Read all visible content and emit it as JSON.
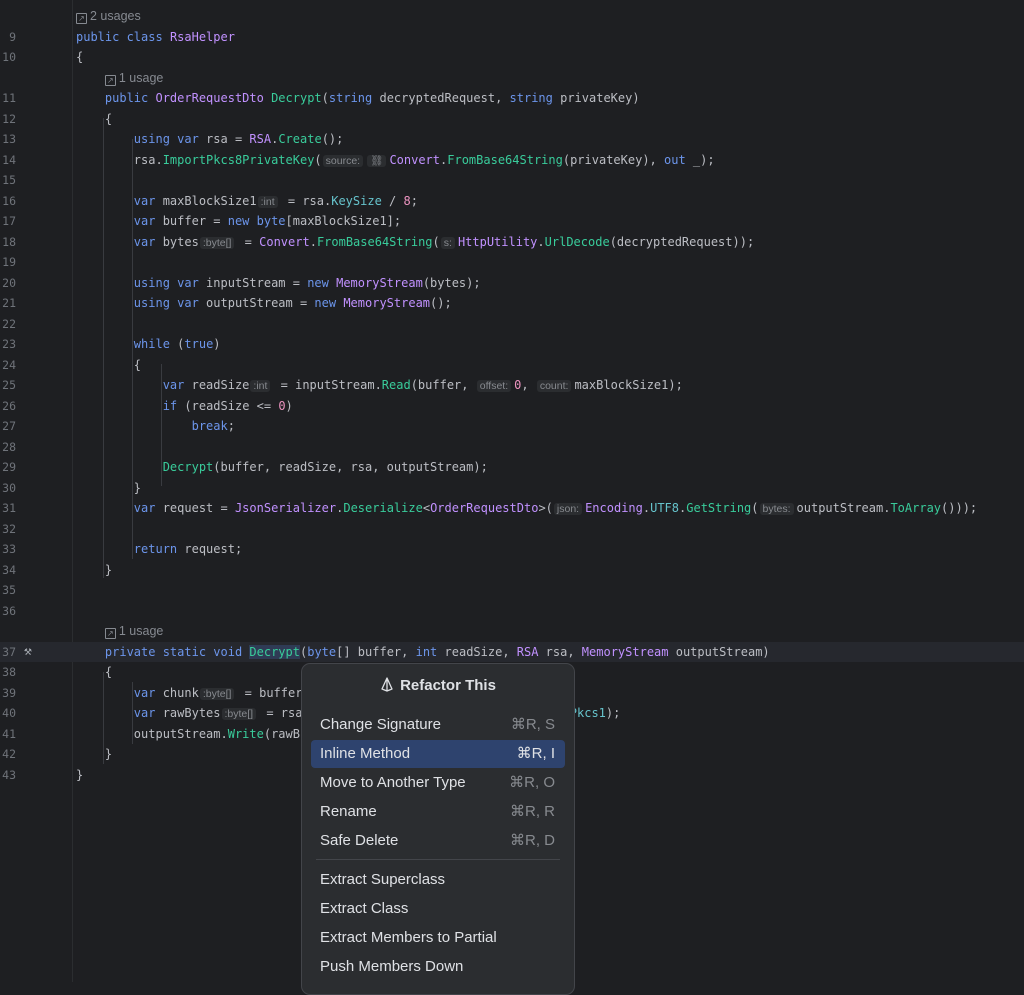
{
  "colors": {
    "background": "#1e1f22",
    "keyword": "#6c95eb",
    "type": "#c191ff",
    "method": "#39cc9b",
    "number": "#ed94c0",
    "selection": "#2e436e"
  },
  "editor": {
    "rows": [
      {
        "usage": "2 usages",
        "indent": 0
      },
      {
        "ln": "9",
        "t": [
          [
            "kw",
            "public "
          ],
          [
            "kw",
            "class "
          ],
          [
            "ty",
            "RsaHelper"
          ]
        ]
      },
      {
        "ln": "10",
        "t": [
          [
            "tx",
            "{"
          ]
        ]
      },
      {
        "usage": "1 usage",
        "indent": 4
      },
      {
        "ln": "11",
        "t": [
          [
            "tx",
            "    "
          ],
          [
            "kw",
            "public "
          ],
          [
            "ty",
            "OrderRequestDto "
          ],
          [
            "fn",
            "Decrypt"
          ],
          [
            "tx",
            "("
          ],
          [
            "kw",
            "string "
          ],
          [
            "tx",
            "decryptedRequest, "
          ],
          [
            "kw",
            "string "
          ],
          [
            "tx",
            "privateKey)"
          ]
        ]
      },
      {
        "ln": "12",
        "t": [
          [
            "tx",
            "    {"
          ]
        ]
      },
      {
        "ln": "13",
        "t": [
          [
            "tx",
            "        "
          ],
          [
            "kw",
            "using var "
          ],
          [
            "tx",
            "rsa = "
          ],
          [
            "ty",
            "RSA"
          ],
          [
            "tx",
            "."
          ],
          [
            "fn",
            "Create"
          ],
          [
            "tx",
            "();"
          ]
        ]
      },
      {
        "ln": "14",
        "t": [
          [
            "tx",
            "        rsa."
          ],
          [
            "fn",
            "ImportPkcs8PrivateKey"
          ],
          [
            "tx",
            "("
          ],
          [
            "hint",
            "source:"
          ],
          [
            "hint",
            "⛓"
          ],
          [
            "ty",
            "Convert"
          ],
          [
            "tx",
            "."
          ],
          [
            "fn",
            "FromBase64String"
          ],
          [
            "tx",
            "(privateKey), "
          ],
          [
            "kw",
            "out "
          ],
          [
            "tx",
            "_);"
          ]
        ]
      },
      {
        "ln": "15",
        "t": []
      },
      {
        "ln": "16",
        "t": [
          [
            "tx",
            "        "
          ],
          [
            "kw",
            "var "
          ],
          [
            "tx",
            "maxBlockSize1"
          ],
          [
            "hint",
            ":int"
          ],
          [
            "tx",
            " = rsa."
          ],
          [
            "prop",
            "KeySize"
          ],
          [
            "tx",
            " / "
          ],
          [
            "num",
            "8"
          ],
          [
            "tx",
            ";"
          ]
        ]
      },
      {
        "ln": "17",
        "t": [
          [
            "tx",
            "        "
          ],
          [
            "kw",
            "var "
          ],
          [
            "tx",
            "buffer = "
          ],
          [
            "kw",
            "new byte"
          ],
          [
            "tx",
            "[maxBlockSize1];"
          ]
        ]
      },
      {
        "ln": "18",
        "t": [
          [
            "tx",
            "        "
          ],
          [
            "kw",
            "var "
          ],
          [
            "tx",
            "bytes"
          ],
          [
            "hint",
            ":byte[]"
          ],
          [
            "tx",
            " = "
          ],
          [
            "ty",
            "Convert"
          ],
          [
            "tx",
            "."
          ],
          [
            "fn",
            "FromBase64String"
          ],
          [
            "tx",
            "("
          ],
          [
            "hint",
            "s:"
          ],
          [
            "ty",
            "HttpUtility"
          ],
          [
            "tx",
            "."
          ],
          [
            "fn",
            "UrlDecode"
          ],
          [
            "tx",
            "(decryptedRequest));"
          ]
        ]
      },
      {
        "ln": "19",
        "t": []
      },
      {
        "ln": "20",
        "t": [
          [
            "tx",
            "        "
          ],
          [
            "kw",
            "using var "
          ],
          [
            "tx",
            "inputStream = "
          ],
          [
            "kw",
            "new "
          ],
          [
            "ty",
            "MemoryStream"
          ],
          [
            "tx",
            "(bytes);"
          ]
        ]
      },
      {
        "ln": "21",
        "t": [
          [
            "tx",
            "        "
          ],
          [
            "kw",
            "using var "
          ],
          [
            "tx",
            "outputStream = "
          ],
          [
            "kw",
            "new "
          ],
          [
            "ty",
            "MemoryStream"
          ],
          [
            "tx",
            "();"
          ]
        ]
      },
      {
        "ln": "22",
        "t": []
      },
      {
        "ln": "23",
        "t": [
          [
            "tx",
            "        "
          ],
          [
            "kw",
            "while "
          ],
          [
            "tx",
            "("
          ],
          [
            "kw",
            "true"
          ],
          [
            "tx",
            ")"
          ]
        ]
      },
      {
        "ln": "24",
        "t": [
          [
            "tx",
            "        {"
          ]
        ]
      },
      {
        "ln": "25",
        "t": [
          [
            "tx",
            "            "
          ],
          [
            "kw",
            "var "
          ],
          [
            "tx",
            "readSize"
          ],
          [
            "hint",
            ":int"
          ],
          [
            "tx",
            " = inputStream."
          ],
          [
            "fn",
            "Read"
          ],
          [
            "tx",
            "(buffer, "
          ],
          [
            "hint",
            "offset:"
          ],
          [
            "num",
            "0"
          ],
          [
            "tx",
            ", "
          ],
          [
            "hint",
            "count:"
          ],
          [
            "tx",
            "maxBlockSize1);"
          ]
        ]
      },
      {
        "ln": "26",
        "t": [
          [
            "tx",
            "            "
          ],
          [
            "kw",
            "if "
          ],
          [
            "tx",
            "(readSize <= "
          ],
          [
            "num",
            "0"
          ],
          [
            "tx",
            ")"
          ]
        ]
      },
      {
        "ln": "27",
        "t": [
          [
            "tx",
            "                "
          ],
          [
            "kw",
            "break"
          ],
          [
            "tx",
            ";"
          ]
        ]
      },
      {
        "ln": "28",
        "t": []
      },
      {
        "ln": "29",
        "t": [
          [
            "tx",
            "            "
          ],
          [
            "fn",
            "Decrypt"
          ],
          [
            "tx",
            "(buffer, readSize, rsa, outputStream);"
          ]
        ]
      },
      {
        "ln": "30",
        "t": [
          [
            "tx",
            "        }"
          ]
        ]
      },
      {
        "ln": "31",
        "t": [
          [
            "tx",
            "        "
          ],
          [
            "kw",
            "var "
          ],
          [
            "tx",
            "request = "
          ],
          [
            "ty",
            "JsonSerializer"
          ],
          [
            "tx",
            "."
          ],
          [
            "fn",
            "Deserialize"
          ],
          [
            "tx",
            "<"
          ],
          [
            "ty",
            "OrderRequestDto"
          ],
          [
            "tx",
            ">("
          ],
          [
            "hint",
            "json:"
          ],
          [
            "ty",
            "Encoding"
          ],
          [
            "tx",
            "."
          ],
          [
            "prop",
            "UTF8"
          ],
          [
            "tx",
            "."
          ],
          [
            "fn",
            "GetString"
          ],
          [
            "tx",
            "("
          ],
          [
            "hint",
            "bytes:"
          ],
          [
            "tx",
            "outputStream."
          ],
          [
            "fn",
            "ToArray"
          ],
          [
            "tx",
            "()));"
          ]
        ]
      },
      {
        "ln": "32",
        "t": []
      },
      {
        "ln": "33",
        "t": [
          [
            "tx",
            "        "
          ],
          [
            "kw",
            "return "
          ],
          [
            "tx",
            "request;"
          ]
        ]
      },
      {
        "ln": "34",
        "t": [
          [
            "tx",
            "    }"
          ]
        ]
      },
      {
        "ln": "35",
        "t": []
      },
      {
        "ln": "36",
        "t": []
      },
      {
        "usage": "1 usage",
        "indent": 4
      },
      {
        "ln": "37",
        "current": true,
        "gutter_icon": "hammer",
        "t": [
          [
            "tx",
            "    "
          ],
          [
            "kw",
            "private static void "
          ],
          [
            "hl",
            "Decrypt"
          ],
          [
            "tx",
            "("
          ],
          [
            "kw",
            "byte"
          ],
          [
            "tx",
            "[] buffer, "
          ],
          [
            "kw",
            "int "
          ],
          [
            "tx",
            "readSize, "
          ],
          [
            "ty",
            "RSA "
          ],
          [
            "tx",
            "rsa, "
          ],
          [
            "ty",
            "MemoryStream "
          ],
          [
            "tx",
            "outputStream)"
          ]
        ]
      },
      {
        "ln": "38",
        "t": [
          [
            "tx",
            "    {"
          ]
        ]
      },
      {
        "ln": "39",
        "t": [
          [
            "tx",
            "        "
          ],
          [
            "kw",
            "var "
          ],
          [
            "tx",
            "chunk"
          ],
          [
            "hint",
            ":byte[]"
          ],
          [
            "tx",
            " = buffer                                  "
          ],
          [
            "fn",
            "y"
          ],
          [
            "tx",
            "();"
          ]
        ]
      },
      {
        "ln": "40",
        "t": [
          [
            "tx",
            "        "
          ],
          [
            "kw",
            "var "
          ],
          [
            "tx",
            "rawBytes"
          ],
          [
            "hint",
            ":byte[]"
          ],
          [
            "tx",
            " = rsa                                     "
          ],
          [
            "prop",
            "Pkcs1"
          ],
          [
            "tx",
            ");"
          ]
        ]
      },
      {
        "ln": "41",
        "t": [
          [
            "tx",
            "        outputStream."
          ],
          [
            "fn",
            "Write"
          ],
          [
            "tx",
            "(rawB"
          ]
        ]
      },
      {
        "ln": "42",
        "t": [
          [
            "tx",
            "    }"
          ]
        ]
      },
      {
        "ln": "43",
        "t": [
          [
            "tx",
            "}"
          ]
        ]
      }
    ]
  },
  "menu": {
    "title": "Refactor This",
    "items": [
      {
        "label": "Change Signature",
        "shortcut": "⌘R, S"
      },
      {
        "label": "Inline Method",
        "shortcut": "⌘R, I",
        "selected": true
      },
      {
        "label": "Move to Another Type",
        "shortcut": "⌘R, O"
      },
      {
        "label": "Rename",
        "shortcut": "⌘R, R"
      },
      {
        "label": "Safe Delete",
        "shortcut": "⌘R, D"
      }
    ],
    "items2": [
      {
        "label": "Extract Superclass"
      },
      {
        "label": "Extract Class"
      },
      {
        "label": "Extract Members to Partial"
      },
      {
        "label": "Push Members Down"
      }
    ]
  }
}
